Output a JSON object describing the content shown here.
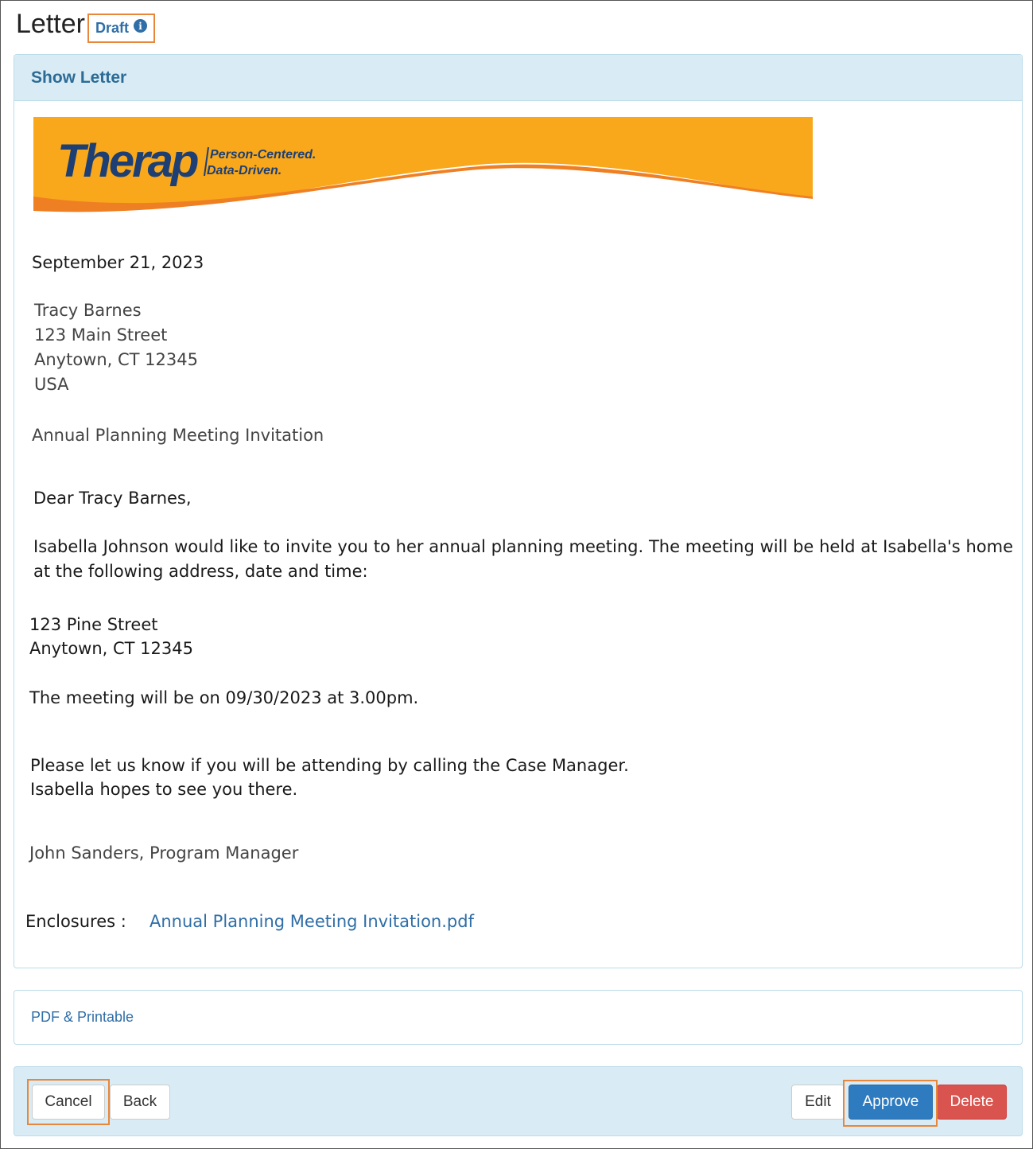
{
  "header": {
    "title": "Letter",
    "status": "Draft"
  },
  "panel": {
    "title": "Show Letter"
  },
  "banner": {
    "brand": "Therap",
    "tagline_line1": "Person-Centered.",
    "tagline_line2": "Data-Driven."
  },
  "letter": {
    "date": "September 21, 2023",
    "recipient": {
      "name": "Tracy Barnes",
      "street": "123 Main Street",
      "city": "Anytown, CT 12345",
      "country": "USA"
    },
    "subject": "Annual Planning Meeting Invitation",
    "salutation": "Dear Tracy Barnes,",
    "body": "Isabella Johnson would like to invite you to her annual planning meeting. The meeting will be held at Isabella's home at the following address, date and time:",
    "meeting_address": {
      "street": "123 Pine Street",
      "city": "Anytown, CT 12345"
    },
    "meeting_time": "The meeting will be on 09/30/2023 at 3.00pm.",
    "closing_line1": "Please let us know if you will be attending by calling the Case Manager.",
    "closing_line2": "Isabella hopes to see you there.",
    "signature": "John Sanders, Program Manager",
    "enclosures_label": "Enclosures :",
    "enclosure_file": "Annual Planning Meeting Invitation.pdf"
  },
  "pdf_panel": {
    "link": "PDF & Printable"
  },
  "footer": {
    "cancel": "Cancel",
    "back": "Back",
    "edit": "Edit",
    "approve": "Approve",
    "delete": "Delete"
  },
  "colors": {
    "accent_blue": "#2f6ea7",
    "panel_bg": "#d9ecf5",
    "highlight_orange": "#e8873a",
    "banner_orange": "#f9a81b",
    "delete_red": "#d9534f"
  }
}
